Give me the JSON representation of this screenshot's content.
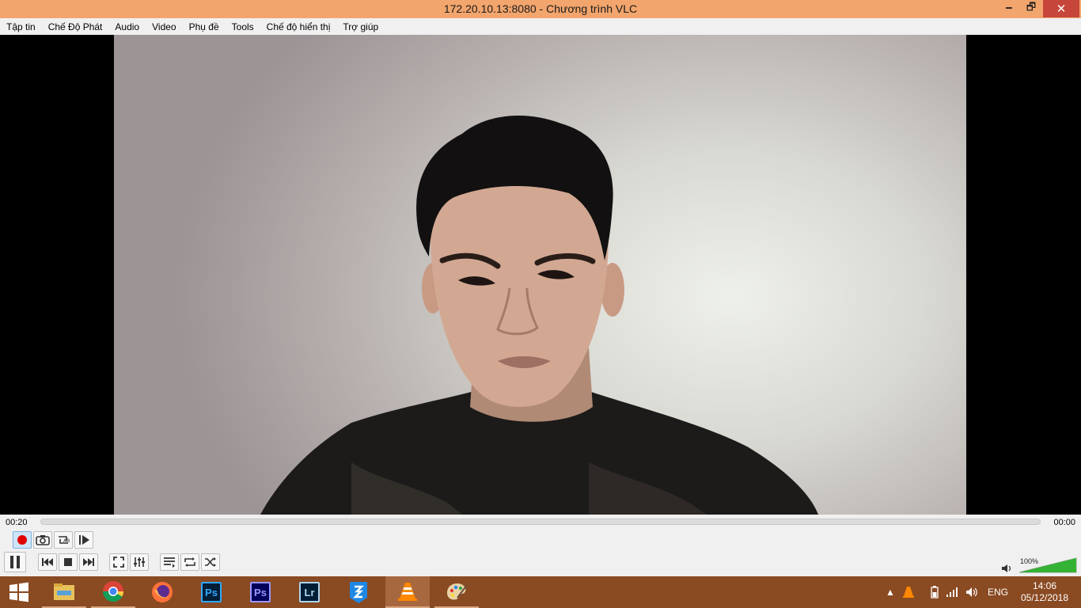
{
  "window": {
    "title": "172.20.10.13:8080 - Chương trình VLC",
    "minimize_glyph": "🗕",
    "restore_glyph": "🗗",
    "close_glyph": "✕"
  },
  "menu": [
    "Tập tin",
    "Chế Độ Phát",
    "Audio",
    "Video",
    "Phụ đề",
    "Tools",
    "Chế độ hiển thị",
    "Trợ giúp"
  ],
  "playback": {
    "elapsed": "00:20",
    "total": "00:00",
    "progress": 0,
    "state": "playing"
  },
  "controls": {
    "row1": [
      "record-icon",
      "snapshot-icon",
      "ab-loop-icon",
      "frame-step-icon"
    ],
    "row2": [
      "pause-icon",
      "previous-icon",
      "stop-icon",
      "next-icon",
      "fullscreen-icon",
      "extended-settings-icon",
      "playlist-icon",
      "loop-icon",
      "shuffle-icon"
    ]
  },
  "volume": {
    "label": "100%",
    "level": 1.0
  },
  "taskbar": {
    "apps": [
      "start-icon",
      "file-explorer-icon",
      "chrome-icon",
      "firefox-icon",
      "photoshop-icon",
      "premiere-icon",
      "lightroom-icon",
      "zalo-icon",
      "vlc-icon",
      "paint-icon"
    ],
    "photoshop_label": "Ps",
    "premiere_label": "Ps",
    "lightroom_label": "Lr",
    "tray_arrow": "▲",
    "language": "ENG",
    "time": "14:06",
    "date": "05/12/2018"
  },
  "colors": {
    "titlebar": "#f2a56c",
    "taskbar": "#8a4a22",
    "close_button": "#c7463a",
    "volume_fill": "#34b233",
    "record_dot": "#e00000"
  }
}
